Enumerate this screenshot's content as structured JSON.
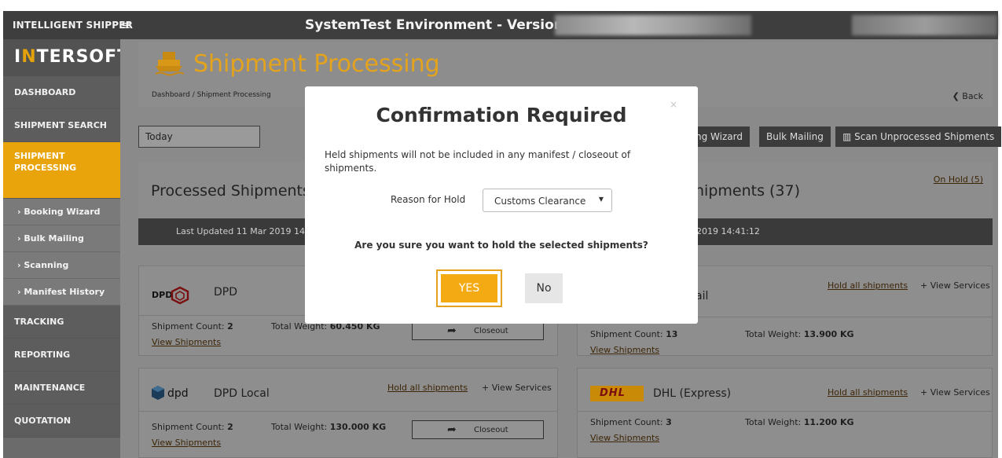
{
  "app": {
    "brand_top": "INTELLIGENT SHIPPER",
    "environment_title": "SystemTest Environment - Version",
    "logo_text_left": "I",
    "logo_text_accent": "N",
    "logo_text_right": "TERSOFT"
  },
  "sidebar": {
    "items": [
      {
        "label": "DASHBOARD"
      },
      {
        "label": "SHIPMENT SEARCH"
      },
      {
        "label": "SHIPMENT PROCESSING"
      },
      {
        "label": "TRACKING"
      },
      {
        "label": "REPORTING"
      },
      {
        "label": "MAINTENANCE"
      },
      {
        "label": "QUOTATION"
      }
    ],
    "sub_items": [
      {
        "label": "› Booking Wizard"
      },
      {
        "label": "› Bulk Mailing"
      },
      {
        "label": "› Scanning"
      },
      {
        "label": "› Manifest History"
      }
    ]
  },
  "page": {
    "title": "Shipment Processing",
    "breadcrumb": "Dashboard  /  Shipment Processing",
    "back_label": "❮ Back",
    "date_filter": "Today"
  },
  "toolbar": {
    "booking_wizard_label": "ng Wizard",
    "bulk_mailing_label": "Bulk Mailing",
    "scan_unprocessed_label": "▥ Scan Unprocessed Shipments"
  },
  "processed": {
    "title": "Processed Shipments",
    "status": "Last Updated 11 Mar 2019 14:41"
  },
  "unprocessed": {
    "title": "hipments (37)",
    "on_hold_link": "On Hold (5)",
    "status": "2019 14:41:12"
  },
  "cards": {
    "dpd": {
      "name": "DPD",
      "logo_text": "DPD",
      "count_label": "Shipment Count:",
      "count": "2",
      "weight_label": "Total Weight:",
      "weight": "60.450 KG",
      "view_link": "View Shipments",
      "closeout_label": "Closeout"
    },
    "dpd_local": {
      "name": "DPD Local",
      "logo_text": "dpd",
      "hold_link": "Hold all shipments",
      "services_link": "+ View Services",
      "count_label": "Shipment Count:",
      "count": "2",
      "weight_label": "Total Weight:",
      "weight": "130.000 KG",
      "view_link": "View Shipments",
      "closeout_label": "Closeout"
    },
    "royal_mail": {
      "name": "ail",
      "hold_link": "Hold all shipments",
      "services_link": "+ View Services",
      "count_label": "Shipment Count:",
      "count": "13",
      "weight_label": "Total Weight:",
      "weight": "13.900 KG",
      "view_link": "View Shipments"
    },
    "dhl": {
      "name": "DHL (Express)",
      "logo_text": "DHL",
      "hold_link": "Hold all shipments",
      "services_link": "+ View Services",
      "count_label": "Shipment Count:",
      "count": "3",
      "weight_label": "Total Weight:",
      "weight": "11.200 KG",
      "view_link": "View Shipments"
    }
  },
  "modal": {
    "close_glyph": "×",
    "title": "Confirmation Required",
    "description": "Held shipments will not be included in any manifest / closeout of shipments.",
    "reason_label": "Reason for Hold",
    "reason_value": "Customs Clearance",
    "question": "Are you sure you want to hold the selected shipments?",
    "yes_label": "YES",
    "no_label": "No"
  },
  "colors": {
    "accent": "#e8a40a",
    "dark": "#3e3e3e",
    "overlay_gray": "#8a8a8a"
  }
}
